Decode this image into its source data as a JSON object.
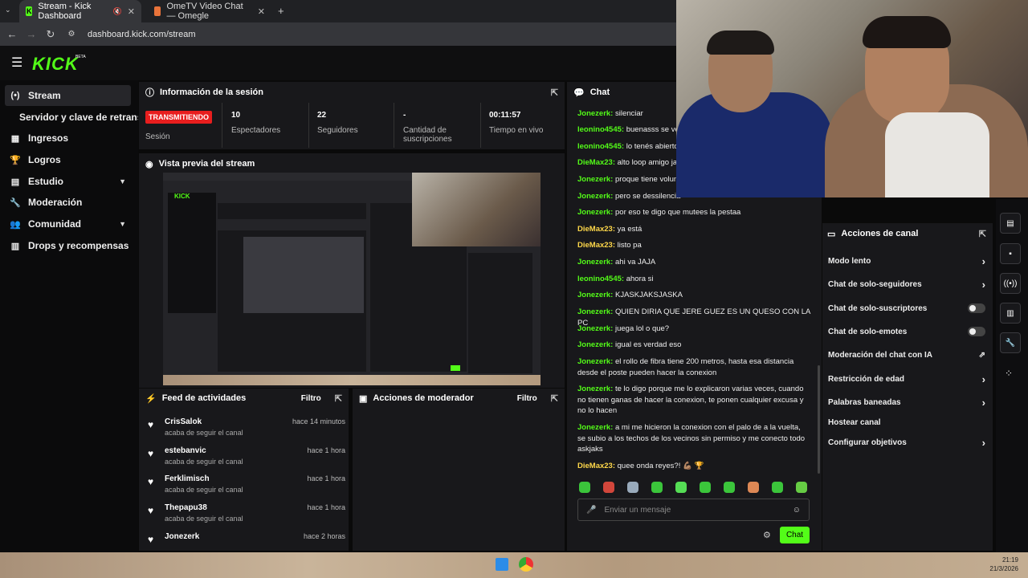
{
  "browser": {
    "tabs": [
      {
        "label": "Stream - Kick Dashboard"
      },
      {
        "label": "OmeTV Video Chat — Omegle"
      }
    ],
    "url": "dashboard.kick.com/stream"
  },
  "app": {
    "logo": "KICK",
    "logo_badge": "BETA"
  },
  "sidebar": {
    "items": [
      {
        "label": "Stream",
        "icon": "broadcast-icon"
      },
      {
        "label": "Servidor y clave de retransm",
        "icon": ""
      },
      {
        "label": "Ingresos",
        "icon": "bank-icon"
      },
      {
        "label": "Logros",
        "icon": "trophy-icon"
      },
      {
        "label": "Estudio",
        "icon": "layout-icon"
      },
      {
        "label": "Moderación",
        "icon": "wrench-icon"
      },
      {
        "label": "Comunidad",
        "icon": "people-icon"
      },
      {
        "label": "Drops y recompensas",
        "icon": "chart-icon"
      }
    ]
  },
  "session": {
    "title": "Información de la sesión",
    "badge": "TRANSMITIENDO",
    "badge_label": "Sesión",
    "stats": [
      {
        "value": "10",
        "label": "Espectadores"
      },
      {
        "value": "22",
        "label": "Seguidores"
      },
      {
        "value": "-",
        "label": "Cantidad de suscripciones"
      },
      {
        "value": "00:11:57",
        "label": "Tiempo en vivo"
      }
    ]
  },
  "preview": {
    "title": "Vista previa del stream"
  },
  "feed": {
    "title": "Feed de actividades",
    "filter": "Filtro",
    "items": [
      {
        "name": "CrisSalok",
        "sub": "acaba de seguir el canal",
        "time": "hace 14 minutos"
      },
      {
        "name": "estebanvic",
        "sub": "acaba de seguir el canal",
        "time": "hace 1 hora"
      },
      {
        "name": "Ferklimisch",
        "sub": "acaba de seguir el canal",
        "time": "hace 1 hora"
      },
      {
        "name": "Thepapu38",
        "sub": "acaba de seguir el canal",
        "time": "hace 1 hora"
      },
      {
        "name": "Jonezerk",
        "sub": "",
        "time": "hace 2 horas"
      }
    ]
  },
  "modactions": {
    "title": "Acciones de moderador",
    "filter": "Filtro"
  },
  "chat": {
    "title": "Chat",
    "messages": [
      {
        "user": "Jonezerk:",
        "text": "silenciar"
      },
      {
        "user": "leonino4545:",
        "text": "buenasss se ve"
      },
      {
        "user": "leonino4545:",
        "text": "lo tenés abierto"
      },
      {
        "user": "DieMax23:",
        "text": "alto loop amigo jaj"
      },
      {
        "user": "Jonezerk:",
        "text": "proque tiene volum"
      },
      {
        "user": "Jonezerk:",
        "text": "pero se dessilencia"
      },
      {
        "user": "Jonezerk:",
        "text": "por eso te digo que mutees la pestaa"
      },
      {
        "user": "DieMax23:",
        "text": "ya está"
      },
      {
        "user": "DieMax23:",
        "text": "listo pa"
      },
      {
        "user": "Jonezerk:",
        "text": "ahi va JAJA"
      },
      {
        "user": "leonino4545:",
        "text": "ahora si"
      },
      {
        "user": "Jonezerk:",
        "text": "KJASKJAKSJASKA"
      },
      {
        "user": "Jonezerk:",
        "text": "QUIEN DIRIA QUE JERE GUEZ ES UN QUESO CON LA PC"
      },
      {
        "user": "Jonezerk:",
        "text": "juega lol o que?"
      },
      {
        "user": "Jonezerk:",
        "text": "igual es verdad eso"
      },
      {
        "user": "Jonezerk:",
        "text": "el rollo de fibra tiene 200 metros, hasta esa distancia desde el poste pueden hacer la conexion"
      },
      {
        "user": "Jonezerk:",
        "text": "te lo digo porque me lo explicaron varias veces, cuando no tienen ganas de hacer la conexion, te ponen cualquier excusa y no lo hacen"
      },
      {
        "user": "Jonezerk:",
        "text": "a mi me hicieron la conexion con el palo de a la vuelta, se subio a los techos de los vecinos sin permiso y me conecto todo askjaks"
      },
      {
        "user": "DieMax23:",
        "text": "queе onda reyes?! 💪🏽 🏆"
      }
    ],
    "placeholder": "Enviar un mensaje",
    "send": "Chat"
  },
  "channel_actions": {
    "title": "Acciones de canal",
    "items": [
      {
        "label": "Modo lento",
        "control": "arrow"
      },
      {
        "label": "Chat de solo-seguidores",
        "control": "arrow"
      },
      {
        "label": "Chat de solo-suscriptores",
        "control": "toggle"
      },
      {
        "label": "Chat de solo-emotes",
        "control": "toggle"
      },
      {
        "label": "Moderación del chat con IA",
        "control": "ext"
      },
      {
        "label": "Restricción de edad",
        "control": "arrow"
      },
      {
        "label": "Palabras baneadas",
        "control": "arrow"
      },
      {
        "label": "Hostear canal",
        "control": "none"
      },
      {
        "label": "Configurar objetivos",
        "control": "arrow"
      }
    ]
  },
  "taskbar": {
    "time": "21:19",
    "date": "21/3/2026"
  },
  "colors": {
    "accent": "#53fc18",
    "live": "#e81e1e",
    "panel": "#18181b"
  }
}
